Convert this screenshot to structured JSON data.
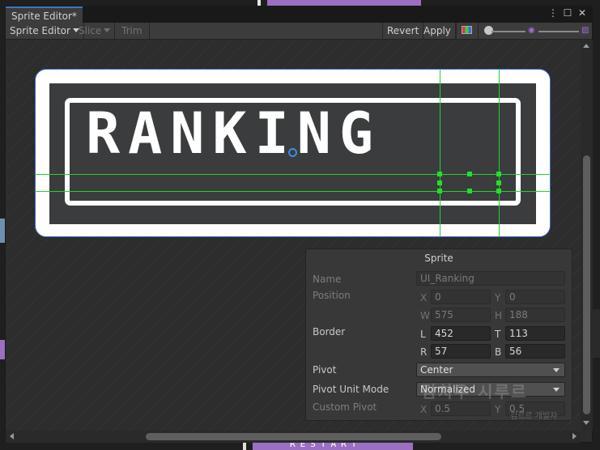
{
  "window": {
    "tab_title": "Sprite Editor*",
    "controls": {
      "menu": "⋮",
      "maximize": "☐",
      "close": "✕"
    }
  },
  "toolbar": {
    "mode_dropdown": "Sprite Editor",
    "slice_dropdown": "Slice",
    "trim": "Trim",
    "revert": "Revert",
    "apply": "Apply"
  },
  "canvas": {
    "sprite_text": "RANKING",
    "colors": {
      "outline_blue": "#3a67c8",
      "slice_green": "#22d42a",
      "pivot_blue": "#3a8ee8",
      "sprite_dark": "#3a3c3e"
    }
  },
  "panel": {
    "title": "Sprite",
    "name_label": "Name",
    "name_value": "UI_Ranking",
    "position_label": "Position",
    "x_axis": "X",
    "x_value": "0",
    "y_axis": "Y",
    "y_value": "0",
    "w_axis": "W",
    "w_value": "575",
    "h_axis": "H",
    "h_value": "188",
    "border_label": "Border",
    "l_axis": "L",
    "l_value": "452",
    "t_axis": "T",
    "t_value": "113",
    "r_axis": "R",
    "r_value": "57",
    "b_axis": "B",
    "b_value": "56",
    "pivot_label": "Pivot",
    "pivot_value": "Center",
    "pivot_unit_label": "Pivot Unit Mode",
    "pivot_unit_value": "Normalized",
    "custom_pivot_label": "Custom Pivot",
    "cp_x_axis": "X",
    "cp_x_value": "0.5",
    "cp_y_axis": "Y",
    "cp_y_value": "0.5"
  },
  "watermark": {
    "main": "김치우 시루르",
    "sub": "김르르 개발자"
  },
  "background": {
    "bottom_text": "RESTART"
  }
}
